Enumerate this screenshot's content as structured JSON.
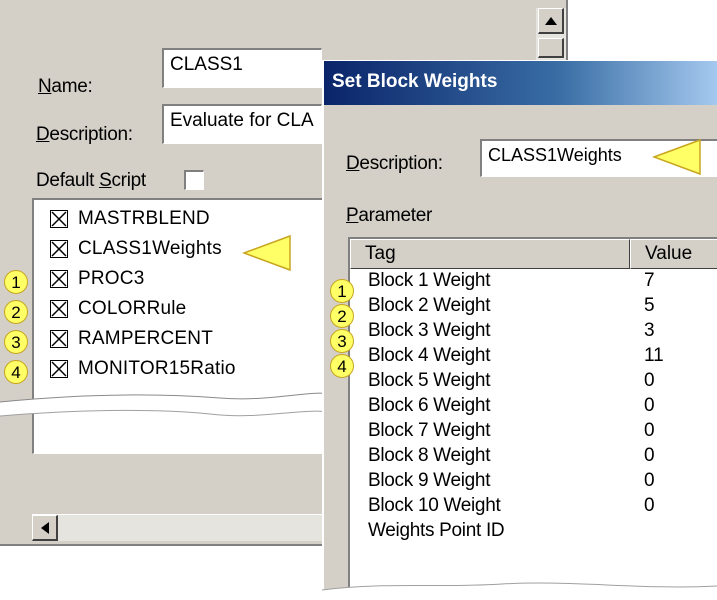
{
  "back_dialog": {
    "name_label_first": "N",
    "name_label_rest": "ame:",
    "name_value": "CLASS1",
    "description_label_first": "D",
    "description_label_rest": "escription:",
    "description_value": "Evaluate for CLA",
    "default_script_label_prefix": "Default ",
    "default_script_label_first": "S",
    "default_script_label_rest": "cript",
    "default_script_checked": false,
    "list_items": [
      {
        "label": "MASTRBLEND",
        "checked": true,
        "callout": ""
      },
      {
        "label": "CLASS1Weights",
        "checked": true,
        "callout": ""
      },
      {
        "label": "PROC3",
        "checked": true,
        "callout": "1"
      },
      {
        "label": "COLORRule",
        "checked": true,
        "callout": "2"
      },
      {
        "label": "RAMPERCENT",
        "checked": true,
        "callout": "3"
      },
      {
        "label": "MONITOR15Ratio",
        "checked": true,
        "callout": "4"
      }
    ]
  },
  "front_dialog": {
    "title": "Set Block Weights",
    "description_label_first": "D",
    "description_label_rest": "escription:",
    "description_value": "CLASS1Weights",
    "parameter_label_first": "P",
    "parameter_label_rest": "arameter",
    "columns": [
      "Tag",
      "Value"
    ],
    "rows": [
      {
        "tag": "Block 1 Weight",
        "value": "7",
        "callout": "1"
      },
      {
        "tag": "Block 2 Weight",
        "value": "5",
        "callout": "2"
      },
      {
        "tag": "Block 3 Weight",
        "value": "3",
        "callout": "3"
      },
      {
        "tag": "Block 4 Weight",
        "value": "11",
        "callout": "4"
      },
      {
        "tag": "Block 5 Weight",
        "value": "0",
        "callout": ""
      },
      {
        "tag": "Block 6 Weight",
        "value": "0",
        "callout": ""
      },
      {
        "tag": "Block 7 Weight",
        "value": "0",
        "callout": ""
      },
      {
        "tag": "Block 8 Weight",
        "value": "0",
        "callout": ""
      },
      {
        "tag": "Block 9 Weight",
        "value": "0",
        "callout": ""
      },
      {
        "tag": "Block 10 Weight",
        "value": "0",
        "callout": ""
      },
      {
        "tag": "Weights Point ID",
        "value": "",
        "callout": ""
      }
    ]
  },
  "icons": {
    "scroll_up": "triangle-up-icon",
    "scroll_left": "triangle-left-icon",
    "checked_box": "checkbox-x-icon",
    "callout_arrow": "yellow-triangle-pointer-icon"
  },
  "colors": {
    "dialog_face": "#d4d0c8",
    "titlebar_start": "#0a246a",
    "titlebar_end": "#a6caf0",
    "callout_fill": "#ffff66",
    "callout_border": "#c7a520"
  }
}
